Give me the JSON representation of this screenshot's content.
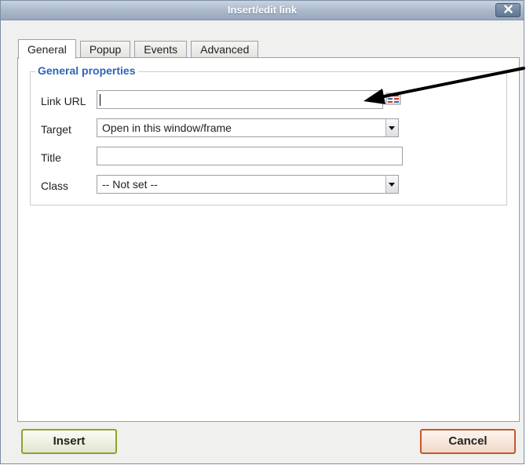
{
  "window": {
    "title": "Insert/edit link"
  },
  "tabs": [
    {
      "label": "General",
      "active": true
    },
    {
      "label": "Popup",
      "active": false
    },
    {
      "label": "Events",
      "active": false
    },
    {
      "label": "Advanced",
      "active": false
    }
  ],
  "general": {
    "legend": "General properties",
    "link_url": {
      "label": "Link URL",
      "value": ""
    },
    "target": {
      "label": "Target",
      "selected": "Open in this window/frame"
    },
    "title": {
      "label": "Title",
      "value": ""
    },
    "class": {
      "label": "Class",
      "selected": "-- Not set --"
    }
  },
  "buttons": {
    "insert": "Insert",
    "cancel": "Cancel"
  },
  "icons": {
    "close": "close-icon",
    "browse": "browse-icon",
    "annotation": "pointer-arrow-icon"
  },
  "colors": {
    "legend": "#2d64b8",
    "insert_border": "#8aa52a",
    "cancel_border": "#c4582e",
    "titlebar": "#a9b7c9"
  }
}
